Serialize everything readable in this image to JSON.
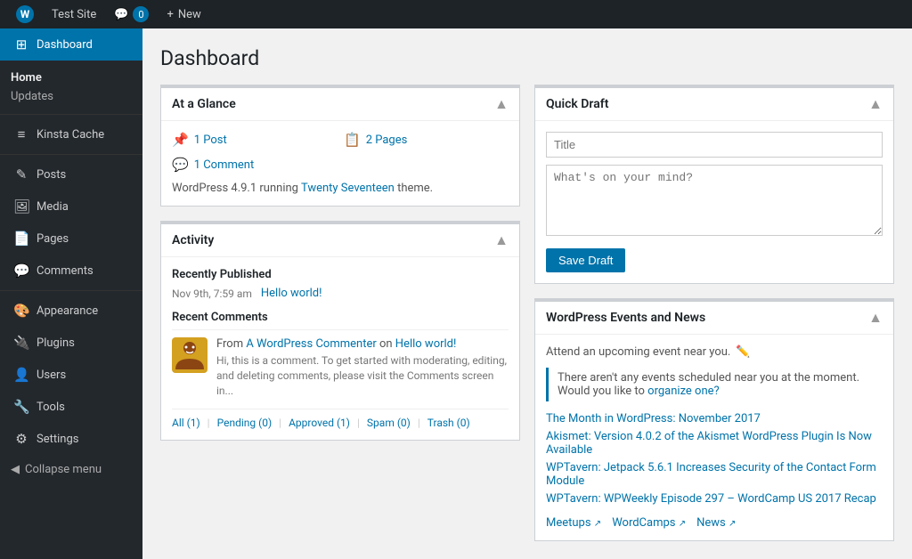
{
  "adminbar": {
    "site_name": "Test Site",
    "comment_count": "0",
    "new_label": "New",
    "wp_logo": "W"
  },
  "sidebar": {
    "active_item": "Dashboard",
    "menu_items": [
      {
        "id": "dashboard",
        "label": "Dashboard",
        "icon": "⊞"
      },
      {
        "id": "home",
        "label": "Home",
        "sub": "Updates"
      },
      {
        "id": "kinsta-cache",
        "label": "Kinsta Cache",
        "icon": "≡"
      },
      {
        "id": "posts",
        "label": "Posts",
        "icon": "✎"
      },
      {
        "id": "media",
        "label": "Media",
        "icon": "🖼"
      },
      {
        "id": "pages",
        "label": "Pages",
        "icon": "📄"
      },
      {
        "id": "comments",
        "label": "Comments",
        "icon": "💬"
      },
      {
        "id": "appearance",
        "label": "Appearance",
        "icon": "🎨"
      },
      {
        "id": "plugins",
        "label": "Plugins",
        "icon": "🔌"
      },
      {
        "id": "users",
        "label": "Users",
        "icon": "👤"
      },
      {
        "id": "tools",
        "label": "Tools",
        "icon": "🔧"
      },
      {
        "id": "settings",
        "label": "Settings",
        "icon": "⚙"
      }
    ],
    "collapse_label": "Collapse menu"
  },
  "page": {
    "title": "Dashboard"
  },
  "at_a_glance": {
    "title": "At a Glance",
    "post_count": "1 Post",
    "page_count": "2 Pages",
    "comment_count": "1 Comment",
    "wp_info": "WordPress 4.9.1 running ",
    "theme_name": "Twenty Seventeen",
    "theme_suffix": " theme."
  },
  "activity": {
    "title": "Activity",
    "recently_published_label": "Recently Published",
    "pub_date": "Nov 9th, 7:59 am",
    "pub_link": "Hello world!",
    "recent_comments_label": "Recent Comments",
    "comment_from_prefix": "From ",
    "comment_author": "A WordPress Commenter",
    "comment_on": " on ",
    "comment_post": "Hello world!",
    "comment_snippet": "Hi, this is a comment. To get started with moderating, editing, and deleting comments, please visit the Comments screen in...",
    "comment_actions": {
      "all": "All (1)",
      "pending": "Pending (0)",
      "approved": "Approved (1)",
      "spam": "Spam (0)",
      "trash": "Trash (0)"
    }
  },
  "quick_draft": {
    "title": "Quick Draft",
    "title_placeholder": "Title",
    "body_placeholder": "What's on your mind?",
    "save_label": "Save Draft"
  },
  "events_news": {
    "title": "WordPress Events and News",
    "attend_text": "Attend an upcoming event near you.",
    "no_events_msg": "There aren't any events scheduled near you at the moment. Would you like to ",
    "organize_link": "organize one?",
    "news_items": [
      "The Month in WordPress: November 2017",
      "Akismet: Version 4.0.2 of the Akismet WordPress Plugin Is Now Available",
      "WPTavern: Jetpack 5.6.1 Increases Security of the Contact Form Module",
      "WPTavern: WPWeekly Episode 297 – WordCamp US 2017 Recap"
    ],
    "footer_links": [
      "Meetups",
      "WordCamps",
      "News"
    ]
  }
}
